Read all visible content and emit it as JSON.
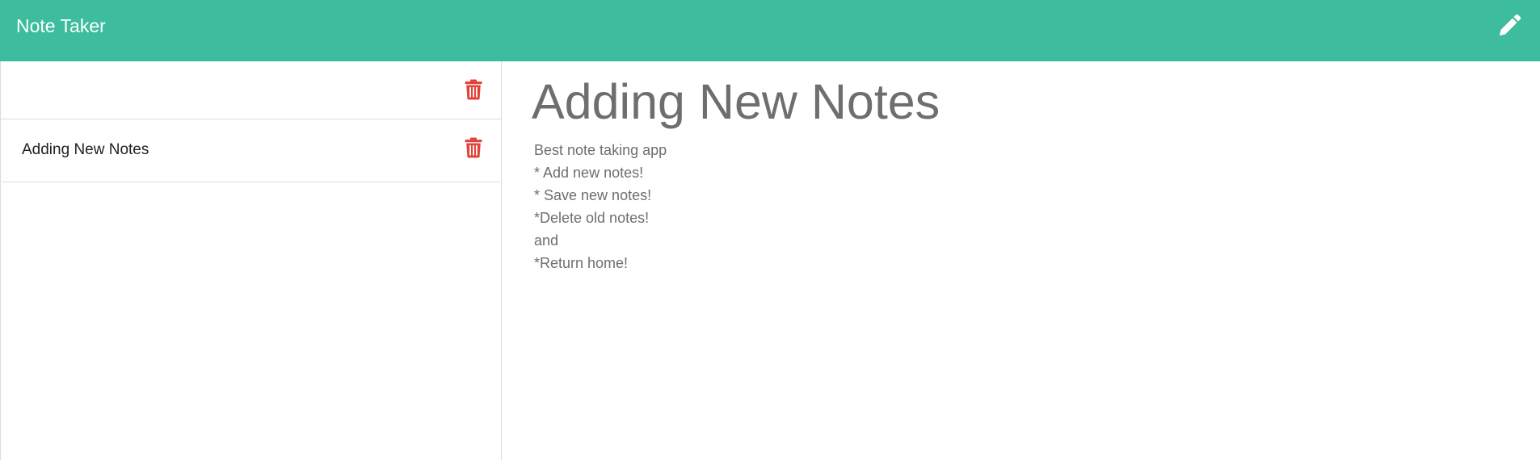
{
  "navbar": {
    "title": "Note Taker",
    "new_note_icon": "pencil-icon",
    "background": "#3dbd9d"
  },
  "sidebar": {
    "notes": [
      {
        "title": "",
        "delete_icon": "trash-icon"
      },
      {
        "title": "Adding New Notes",
        "delete_icon": "trash-icon"
      }
    ],
    "delete_color": "#e0443a"
  },
  "main": {
    "note_title": "Adding New Notes",
    "note_text_lines": [
      "Best note taking app",
      "* Add new notes!",
      "* Save new notes!",
      "*Delete old notes!",
      "and",
      "*Return home!"
    ]
  }
}
